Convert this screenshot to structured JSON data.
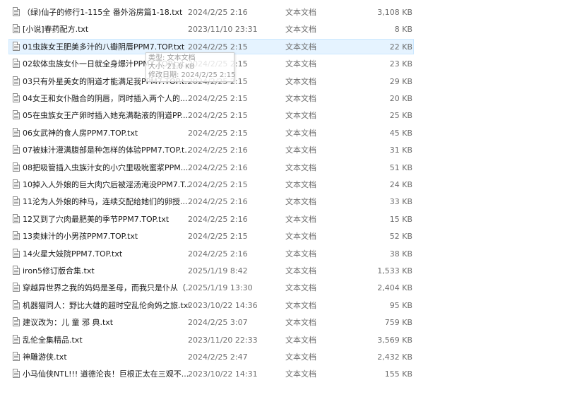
{
  "files": [
    {
      "name": "（绿)仙子的修行1-115全 番外浴房篇1-18.txt",
      "date": "2024/2/25 2:16",
      "type": "文本文档",
      "size": "3,108 KB"
    },
    {
      "name": "[小说]春药配方.txt",
      "date": "2023/11/10 23:31",
      "type": "文本文档",
      "size": "8 KB"
    },
    {
      "name": "01虫族女王肥美多汁的八瓣阴唇PPM7.TOP.txt",
      "date": "2024/2/25 2:15",
      "type": "文本文档",
      "size": "22 KB"
    },
    {
      "name": "02软体虫族女仆一日就全身爆汁PPM7.TOP.txt",
      "date": "2024/2/25 2:15",
      "type": "文本文档",
      "size": "23 KB"
    },
    {
      "name": "03只有外星美女的阴道才能满足我PPM7.TOP.t...",
      "date": "2024/2/25 2:15",
      "type": "文本文档",
      "size": "29 KB"
    },
    {
      "name": "04女王和女仆融合的阴唇，同时插入两个人的...",
      "date": "2024/2/25 2:15",
      "type": "文本文档",
      "size": "20 KB"
    },
    {
      "name": "05在虫族女王产卵时插入她充满黏液的阴道PP...",
      "date": "2024/2/25 2:15",
      "type": "文本文档",
      "size": "25 KB"
    },
    {
      "name": "06女武神的食人房PPM7.TOP.txt",
      "date": "2024/2/25 2:15",
      "type": "文本文档",
      "size": "45 KB"
    },
    {
      "name": "07被妹汁灌满腹部是种怎样的体验PPM7.TOP.t...",
      "date": "2024/2/25 2:16",
      "type": "文本文档",
      "size": "31 KB"
    },
    {
      "name": "08把吸管插入虫族汁女的小穴里吸吮蜜浆PPM...",
      "date": "2024/2/25 2:16",
      "type": "文本文档",
      "size": "51 KB"
    },
    {
      "name": "10掉入人外娘的巨大肉穴后被淫汤淹没PPM7.T...",
      "date": "2024/2/25 2:15",
      "type": "文本文档",
      "size": "24 KB"
    },
    {
      "name": "11沦为人外娘的种马，连续交配给她们的卵授...",
      "date": "2024/2/25 2:16",
      "type": "文本文档",
      "size": "33 KB"
    },
    {
      "name": "12又到了穴肉最肥美的季节PPM7.TOP.txt",
      "date": "2024/2/25 2:16",
      "type": "文本文档",
      "size": "15 KB"
    },
    {
      "name": "13卖妹汁的小男孩PPM7.TOP.txt",
      "date": "2024/2/25 2:15",
      "type": "文本文档",
      "size": "52 KB"
    },
    {
      "name": "14火星大妓院PPM7.TOP.txt",
      "date": "2024/2/25 2:16",
      "type": "文本文档",
      "size": "38 KB"
    },
    {
      "name": "iron5修订版合集.txt",
      "date": "2025/1/19 8:42",
      "type": "文本文档",
      "size": "1,533 KB"
    },
    {
      "name": "穿越异世界之我的妈妈是圣母，而我只是仆从（...",
      "date": "2025/1/19 13:30",
      "type": "文本文档",
      "size": "2,404 KB"
    },
    {
      "name": "机器猫同人：野比大雄的超时空乱伦肏妈之旅.txt",
      "date": "2023/10/22 14:36",
      "type": "文本文档",
      "size": "95 KB"
    },
    {
      "name": "建议改为：儿 童 邪 典.txt",
      "date": "2024/2/25 3:07",
      "type": "文本文档",
      "size": "759 KB"
    },
    {
      "name": "乱伦全集精品.txt",
      "date": "2023/11/20 22:33",
      "type": "文本文档",
      "size": "3,569 KB"
    },
    {
      "name": "神雕游侠.txt",
      "date": "2024/2/25 2:47",
      "type": "文本文档",
      "size": "2,432 KB"
    },
    {
      "name": "小马仙侠NTL!!! 道德沦丧！巨根正太在三观不...",
      "date": "2023/10/22 14:31",
      "type": "文本文档",
      "size": "155 KB"
    }
  ],
  "selected_index": 2,
  "tooltip": {
    "type_line": "类型: 文本文档",
    "size_line": "大小: 21.0 KB",
    "modified_line": "修改日期: 2024/2/25 2:15"
  }
}
